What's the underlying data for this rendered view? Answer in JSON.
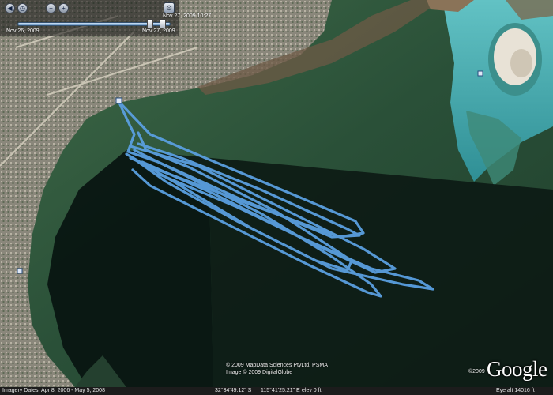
{
  "map": {
    "view": "satellite-3d",
    "colors": {
      "water_deep": "#0e2a1f",
      "water_shallow": "#2f5c3d",
      "channel": "#4fb3b3",
      "land": "#8c8a80",
      "track": "#5a9fe0"
    },
    "placemarks": [
      {
        "icon": "placemark-icon"
      },
      {
        "icon": "placemark-icon"
      }
    ]
  },
  "timebar": {
    "range_start": "Nov 26, 2009",
    "range_end": "Nov 27, 2009",
    "current_time": "Nov 27, 2009 10:27",
    "controls": [
      {
        "name": "step-back-button",
        "icon": "chevron-left-icon",
        "glyph": "◀"
      },
      {
        "name": "timebar-options-button",
        "icon": "clock-icon",
        "glyph": "◷"
      },
      {
        "name": "zoom-out-time-button",
        "icon": "zoom-out-icon",
        "glyph": "−"
      },
      {
        "name": "zoom-in-time-button",
        "icon": "zoom-in-icon",
        "glyph": "+"
      }
    ],
    "settings_icon": "wrench-icon",
    "settings_glyph": "⚙"
  },
  "attribution": {
    "line1": "© 2009 MapData Sciences PtyLtd, PSMA",
    "line2": "Image © 2009 DigitalGlobe"
  },
  "logo": {
    "year": "©2009",
    "text": "Google"
  },
  "status": {
    "imagery_dates": "Imagery Dates: Apr 8, 2006 - May 5, 2008",
    "latitude": "32°34'49.12\" S",
    "longitude": "115°41'25.21\" E",
    "elev": "elev     0 ft",
    "eye_alt": "Eye alt  14016 ft"
  }
}
